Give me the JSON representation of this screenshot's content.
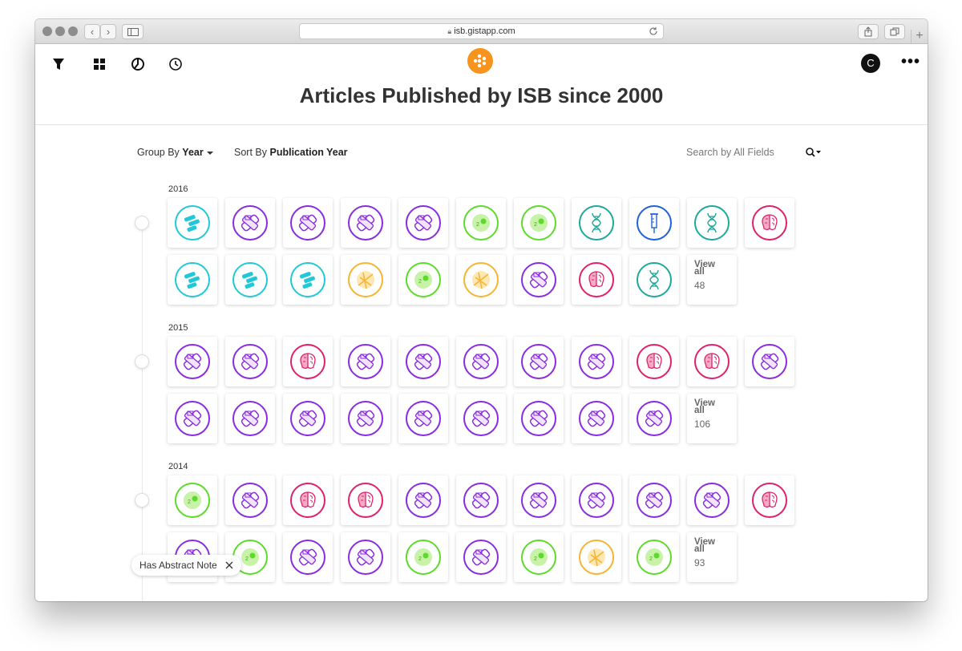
{
  "browser": {
    "url": "isb.gistapp.com"
  },
  "app": {
    "title": "Articles Published by ISB since 2000",
    "user_initial": "C",
    "more_label": "•••"
  },
  "toolbar": {
    "group_prefix": "Group By",
    "group_value": "Year",
    "sort_prefix": "Sort By",
    "sort_value": "Publication Year",
    "search_placeholder": "Search by All Fields"
  },
  "colors": {
    "bacteria": "#22c8d8",
    "bandage": "#8a2be2",
    "cell": "#5ddb2a",
    "dna": "#1ea89a",
    "syringe": "#2060d8",
    "brain": "#e0206a",
    "tools": "#f5b530"
  },
  "groups": [
    {
      "year": "2016",
      "rows": [
        [
          "bacteria-icon",
          "bandage-icon",
          "bandage-icon",
          "bandage-icon",
          "bandage-icon",
          "cell-icon",
          "cell-icon",
          "dna-icon",
          "syringe-icon",
          "dna-icon",
          "brain-icon"
        ],
        [
          "bacteria-icon",
          "bacteria-icon",
          "bacteria-icon",
          "tools-icon",
          "cell-icon",
          "tools-icon",
          "bandage-icon",
          "brain-icon",
          "dna-icon"
        ]
      ],
      "view_all_label": "View all",
      "view_all_count": "48"
    },
    {
      "year": "2015",
      "rows": [
        [
          "bandage-icon",
          "bandage-icon",
          "brain-icon",
          "bandage-icon",
          "bandage-icon",
          "bandage-icon",
          "bandage-icon",
          "bandage-icon",
          "brain-icon",
          "brain-icon",
          "bandage-icon"
        ],
        [
          "bandage-icon",
          "bandage-icon",
          "bandage-icon",
          "bandage-icon",
          "bandage-icon",
          "bandage-icon",
          "bandage-icon",
          "bandage-icon",
          "bandage-icon"
        ]
      ],
      "view_all_label": "View all",
      "view_all_count": "106"
    },
    {
      "year": "2014",
      "rows": [
        [
          "cell-icon",
          "bandage-icon",
          "brain-icon",
          "brain-icon",
          "bandage-icon",
          "bandage-icon",
          "bandage-icon",
          "bandage-icon",
          "bandage-icon",
          "bandage-icon",
          "brain-icon"
        ],
        [
          "bandage-icon",
          "cell-icon",
          "bandage-icon",
          "bandage-icon",
          "cell-icon",
          "bandage-icon",
          "cell-icon",
          "tools-icon",
          "cell-icon"
        ]
      ],
      "view_all_label": "View all",
      "view_all_count": "93"
    }
  ],
  "filter_chip": {
    "label": "Has Abstract Note"
  }
}
